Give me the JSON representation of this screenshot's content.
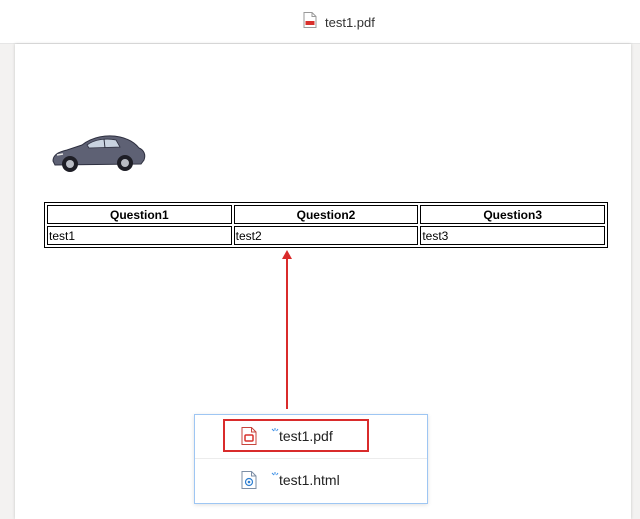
{
  "window": {
    "title": "test1.pdf",
    "icon": "pdf-file-icon"
  },
  "document": {
    "image": "car-image",
    "table": {
      "headers": [
        "Question1",
        "Question2",
        "Question3"
      ],
      "rows": [
        [
          "test1",
          "test2",
          "test3"
        ]
      ]
    }
  },
  "popup": {
    "items": [
      {
        "label": "test1.pdf",
        "icon": "pdf-file-icon",
        "highlighted": true
      },
      {
        "label": "test1.html",
        "icon": "html-file-icon",
        "highlighted": false
      }
    ]
  },
  "annotation": {
    "color": "#d92b2b"
  }
}
